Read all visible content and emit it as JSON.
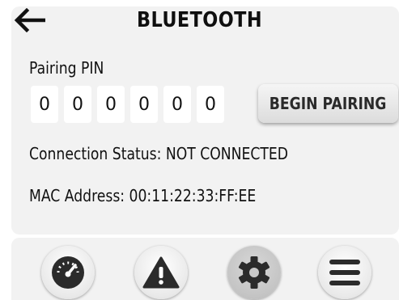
{
  "header": {
    "title": "BLUETOOTH",
    "back_icon": "arrow-left-icon"
  },
  "pairing": {
    "label": "Pairing PIN",
    "pin_digits": [
      "0",
      "0",
      "0",
      "0",
      "0",
      "0"
    ],
    "button_label": "BEGIN PAIRING"
  },
  "status": {
    "connection": "Connection Status: NOT CONNECTED",
    "mac": "MAC Address: 00:11:22:33:FF:EE"
  },
  "nav": {
    "items": [
      {
        "icon": "speedometer-icon",
        "active": false
      },
      {
        "icon": "warning-icon",
        "active": false
      },
      {
        "icon": "gear-icon",
        "active": true
      },
      {
        "icon": "hamburger-menu-icon",
        "active": false
      }
    ]
  }
}
